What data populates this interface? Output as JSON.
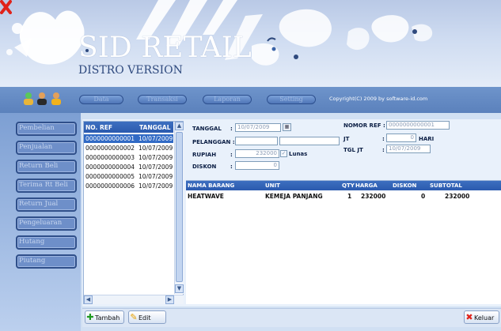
{
  "app": {
    "brand": "SID RETAIL",
    "edition": "DISTRO VERSION"
  },
  "menubar": {
    "items": [
      "Data",
      "Transaksi",
      "Laporan",
      "Setting"
    ],
    "copyright": "Copyright(C) 2009 by software-id.com"
  },
  "nav": {
    "items": [
      "Pembelian",
      "Penjualan",
      "Return Beli",
      "Terima Rt Beli",
      "Return Jual",
      "Pengeluaran",
      "Hutang",
      "Piutang"
    ]
  },
  "list": {
    "columns": [
      "NO. REF",
      "TANGGAL"
    ],
    "rows": [
      [
        "0000000000001",
        "10/07/2009"
      ],
      [
        "0000000000002",
        "10/07/2009"
      ],
      [
        "0000000000003",
        "10/07/2009"
      ],
      [
        "0000000000004",
        "10/07/2009"
      ],
      [
        "0000000000005",
        "10/07/2009"
      ],
      [
        "0000000000006",
        "10/07/2009"
      ]
    ],
    "selected_index": 0
  },
  "form": {
    "tanggal_label": "TANGGAL",
    "tanggal_value": "10/07/2009",
    "pelanggan_label": "PELANGGAN :",
    "rupiah_label": "RUPIAH",
    "rupiah_value": "232000",
    "lunas_label": "Lunas",
    "lunas_checked": true,
    "diskon_label": "DISKON",
    "diskon_value": "0",
    "nomor_ref_label": "NOMOR REF :",
    "nomor_ref_value": "0000000000001",
    "jt_label": "JT",
    "jt_value": "0",
    "hari_label": "HARI",
    "tgl_jt_label": "TGL JT",
    "tgl_jt_value": "10/07/2009",
    "colon": ":"
  },
  "detail": {
    "columns": [
      "NAMA BARANG",
      "UNIT",
      "QTY",
      "HARGA",
      "DISKON",
      "SUBTOTAL"
    ],
    "rows": [
      [
        "HEATWAVE",
        "KEMEJA PANJANG",
        "1",
        "232000",
        "0",
        "232000"
      ]
    ]
  },
  "toolbar": {
    "tambah": "Tambah",
    "edit": "Edit",
    "keluar": "Keluar"
  },
  "colors": {
    "accent": "#316ac5",
    "menubar": "#5b81bc",
    "panel": "#d1e0f3",
    "close": "#e0221a"
  }
}
